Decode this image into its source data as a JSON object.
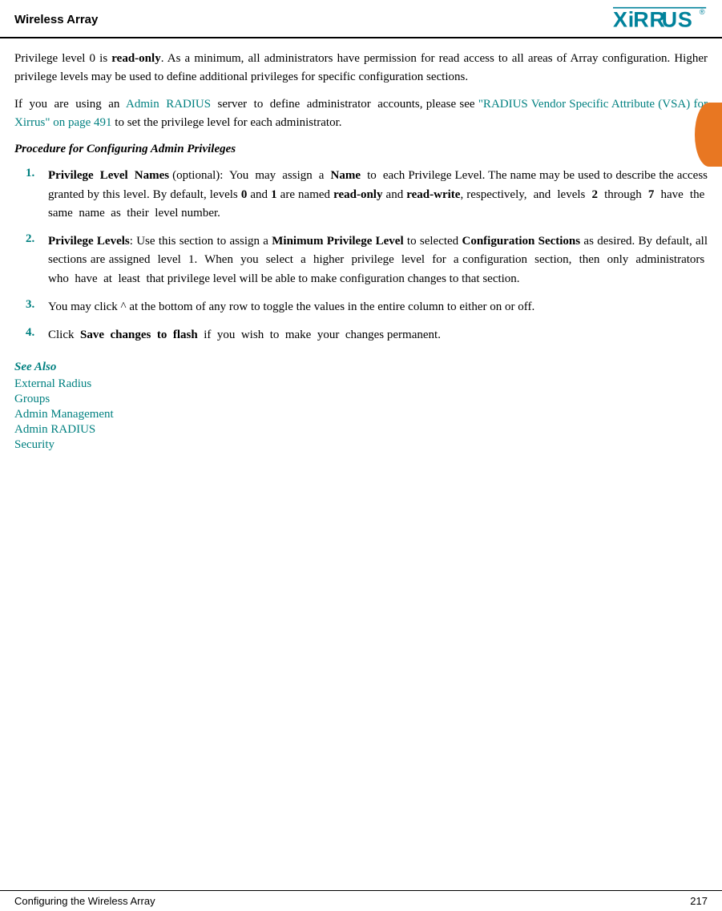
{
  "header": {
    "title": "Wireless Array",
    "logo_alt": "XIRRUS logo"
  },
  "content": {
    "intro_paragraph1": "Privilege level 0 is read-only. As a minimum, all administrators have permission for read access to all areas of Array configuration. Higher privilege levels may be used to define additional privileges for specific configuration sections.",
    "intro_paragraph1_bold": "read-only",
    "intro_paragraph2_prefix": "If  you  are  using  an",
    "intro_paragraph2_link1": "Admin  RADIUS",
    "intro_paragraph2_middle": "server  to  define  administrator  accounts, please see",
    "intro_paragraph2_link2": "“RADIUS Vendor Specific Attribute (VSA) for Xirrus” on page 491",
    "intro_paragraph2_suffix": "to set the privilege level for each administrator.",
    "procedure_heading": "Procedure for Configuring Admin Privileges",
    "list_items": [
      {
        "number": "1.",
        "bold_start": "Privilege  Level  Names",
        "text": " (optional):  You  may  assign  a ",
        "bold_name": "Name",
        "text2": " to  each Privilege Level. The name may be used to describe the access granted by this level. By default, levels ",
        "bold_0": "0",
        "text3": " and ",
        "bold_1": "1",
        "text4": " are named ",
        "bold_readonly": "read-only",
        "text5": " and ",
        "bold_readwrite": "read-write",
        "text6": ", respectively,  and  levels ",
        "bold_2": "2",
        "text7": " through ",
        "bold_7": "7",
        "text8": " have  the  same  name  as  their  level number."
      },
      {
        "number": "2.",
        "bold_start": "Privilege Levels",
        "text": ": Use this section to assign a ",
        "bold_min": "Minimum Privilege Level",
        "text2": " to selected ",
        "bold_config": "Configuration Sections",
        "text3": " as desired. By default, all sections are assigned  level  1.  When  you  select  a  higher  privilege  level  for  a configuration  section,  then  only  administrators  who  have  at  least  that privilege level will be able to make configuration changes to that section."
      },
      {
        "number": "3.",
        "text": "You may click ^ at the bottom of any row to toggle the values in the entire column to either on or off."
      },
      {
        "number": "4.",
        "text_prefix": "Click ",
        "bold_save": "Save  changes  to  flash",
        "text_suffix": " if  you  wish  to  make  your  changes permanent."
      }
    ],
    "see_also_heading": "See Also",
    "see_also_links": [
      "External Radius",
      "Groups",
      "Admin Management",
      "Admin RADIUS",
      "Security"
    ]
  },
  "footer": {
    "left": "Configuring the Wireless Array",
    "right": "217"
  }
}
